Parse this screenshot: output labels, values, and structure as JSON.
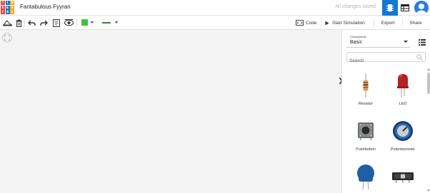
{
  "app": {
    "logo_letters": [
      "T",
      "I",
      "N",
      "K",
      "E",
      "R",
      "C",
      "A",
      "D"
    ],
    "logo_colors": [
      "#e8413a",
      "#1b79c4",
      "#fca31c",
      "#e8413a",
      "#1b79c4",
      "#fca31c",
      "#e8413a",
      "#1b79c4",
      "#fca31c"
    ],
    "project_title": "Fantabulous Fyyran",
    "save_status": "All changes saved",
    "accent_color": "#1477d1"
  },
  "toolbar": {
    "tools": [
      "workplane-icon",
      "delete-icon",
      "undo-icon",
      "redo-icon",
      "notes-icon",
      "visibility-icon"
    ],
    "wire_color": "#3fc140",
    "code_label": "Code",
    "simulate_label": "Start Simulation",
    "export_label": "Export",
    "share_label": "Share"
  },
  "panel": {
    "dropdown_label": "Components",
    "dropdown_value": "Basic",
    "search_placeholder": "Search",
    "components": [
      {
        "name": "Resistor",
        "icon": "resistor-icon"
      },
      {
        "name": "LED",
        "icon": "led-icon"
      },
      {
        "name": "Pushbutton",
        "icon": "pushbutton-icon"
      },
      {
        "name": "Potentiometer",
        "icon": "potentiometer-icon"
      },
      {
        "name": "",
        "icon": "capacitor-icon"
      },
      {
        "name": "",
        "icon": "slide-switch-icon"
      }
    ]
  }
}
